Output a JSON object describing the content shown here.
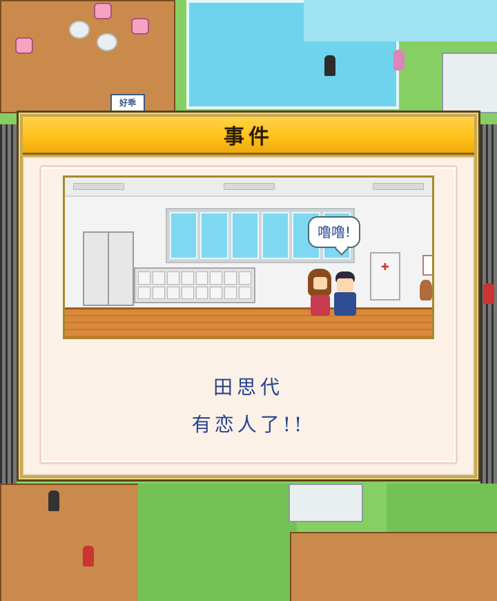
{
  "map": {
    "sign_text": "好乖"
  },
  "event_dialog": {
    "title": "事件",
    "speech_bubble": "噜噜!",
    "message_name": "田思代",
    "message_text": "有恋人了!!"
  },
  "colors": {
    "header_gold": "#ffc21a",
    "frame_gold": "#c9a84e",
    "message_blue": "#28418f",
    "panel_cream": "#fbf1e7"
  }
}
